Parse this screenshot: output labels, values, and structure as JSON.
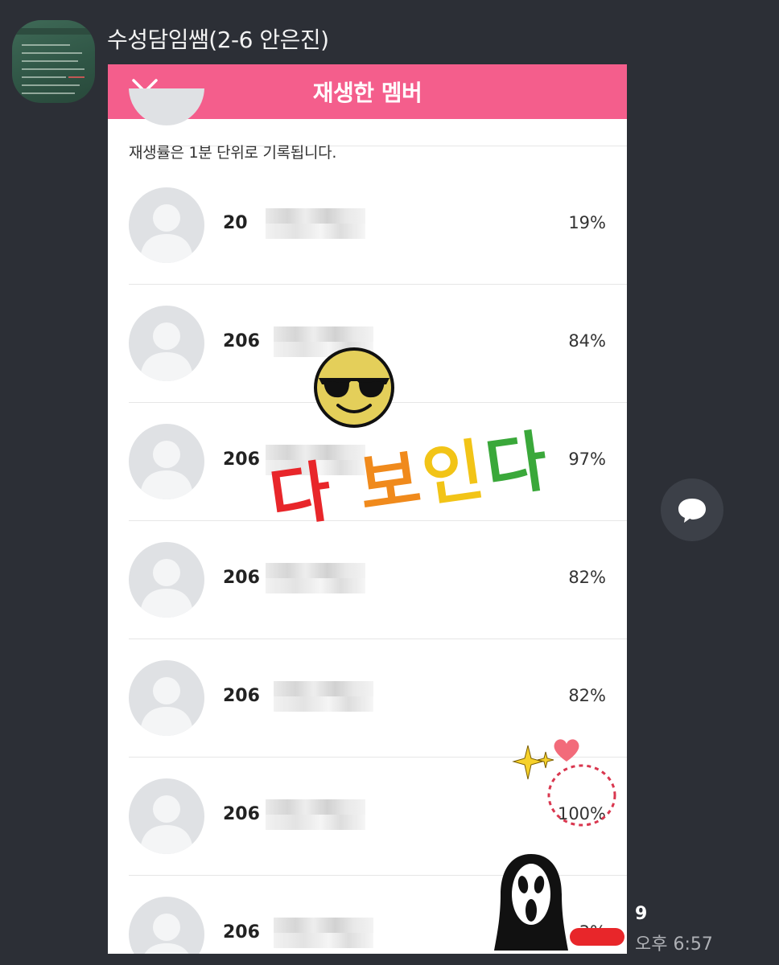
{
  "chat": {
    "sender_name": "수성담임쌤(2-6 안은진)",
    "read_count": "9",
    "time": "오후 6:57"
  },
  "screenshot": {
    "header_title": "재생한 멤버",
    "note": "재생률은 1분 단위로 기록됩니다.",
    "members": [
      {
        "id_prefix": "20",
        "percent": "19%"
      },
      {
        "id_prefix": "206",
        "percent": "84%"
      },
      {
        "id_prefix": "206",
        "percent": "97%"
      },
      {
        "id_prefix": "206",
        "percent": "82%"
      },
      {
        "id_prefix": "206",
        "percent": "82%"
      },
      {
        "id_prefix": "206",
        "percent": "100%"
      },
      {
        "id_prefix": "206",
        "percent": "3%"
      }
    ]
  },
  "stickers": {
    "text_chars": [
      "다",
      " ",
      "보",
      "인",
      "다"
    ],
    "text_colors": [
      "#e8262a",
      "#ffffff",
      "#f08a1c",
      "#f2c417",
      "#3aa83a"
    ]
  },
  "colors": {
    "header": "#f45e8c",
    "background": "#2c2f36"
  }
}
